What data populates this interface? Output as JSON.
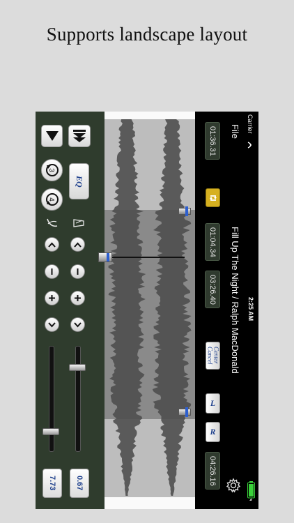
{
  "caption": "Supports landscape layout",
  "status_bar": {
    "carrier": "Carrier",
    "time": "2:25 AM"
  },
  "header": {
    "file_label": "File",
    "song_title": "Fill Up The Night / Ralph MacDonald"
  },
  "times": {
    "current": "01:36.31",
    "loop_start": "01:04.34",
    "loop_end": "03:26.40",
    "total": "04:26.16"
  },
  "buttons": {
    "eq": "EQ",
    "center_cancel_line1": "Center",
    "center_cancel_line2": "Cancel",
    "left": "L",
    "right": "R"
  },
  "controls": {
    "speed_value": "7.73",
    "pitch_value": "0.67"
  },
  "icons": {
    "down": "triangle-down-icon",
    "skip": "skip-to-start-icon",
    "rewind": "rewind-3-icon",
    "forward": "forward-4-icon",
    "speed": "speed-icon",
    "pitch": "metronome-icon",
    "settings": "gear-icon",
    "loop": "loop-icon",
    "battery": "battery-icon",
    "wifi": "wifi-icon"
  },
  "colors": {
    "panel": "#2f3c2d",
    "loop_button": "#d6b020",
    "value_text": "#1d3f8c",
    "battery": "#3ad13a"
  }
}
